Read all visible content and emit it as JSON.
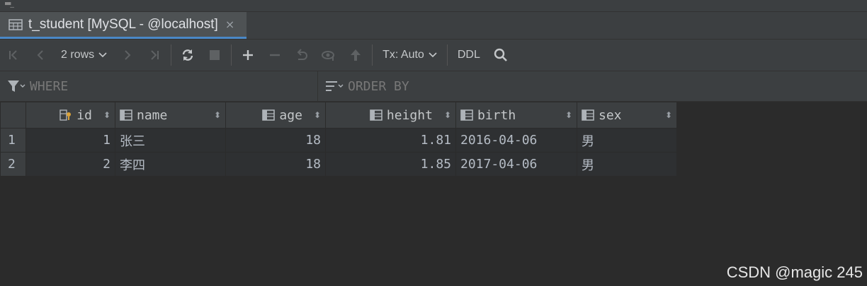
{
  "tab": {
    "title": "t_student [MySQL - @localhost]",
    "close_glyph": "×"
  },
  "toolbar": {
    "rows_label": "2 rows",
    "tx_label": "Tx: Auto",
    "ddl_label": "DDL"
  },
  "filter": {
    "where_placeholder": "WHERE",
    "order_placeholder": "ORDER BY"
  },
  "grid": {
    "columns": [
      "id",
      "name",
      "age",
      "height",
      "birth",
      "sex"
    ],
    "rows": [
      {
        "num": "1",
        "id": "1",
        "name": "张三",
        "age": "18",
        "height": "1.81",
        "birth": "2016-04-06",
        "sex": "男"
      },
      {
        "num": "2",
        "id": "2",
        "name": "李四",
        "age": "18",
        "height": "1.85",
        "birth": "2017-04-06",
        "sex": "男"
      }
    ]
  },
  "watermark": "CSDN @magic 245",
  "colors": {
    "background": "#2b2b2b",
    "toolbar": "#3c3f41",
    "accent": "#4a88c7",
    "key": "#d9a23a"
  }
}
